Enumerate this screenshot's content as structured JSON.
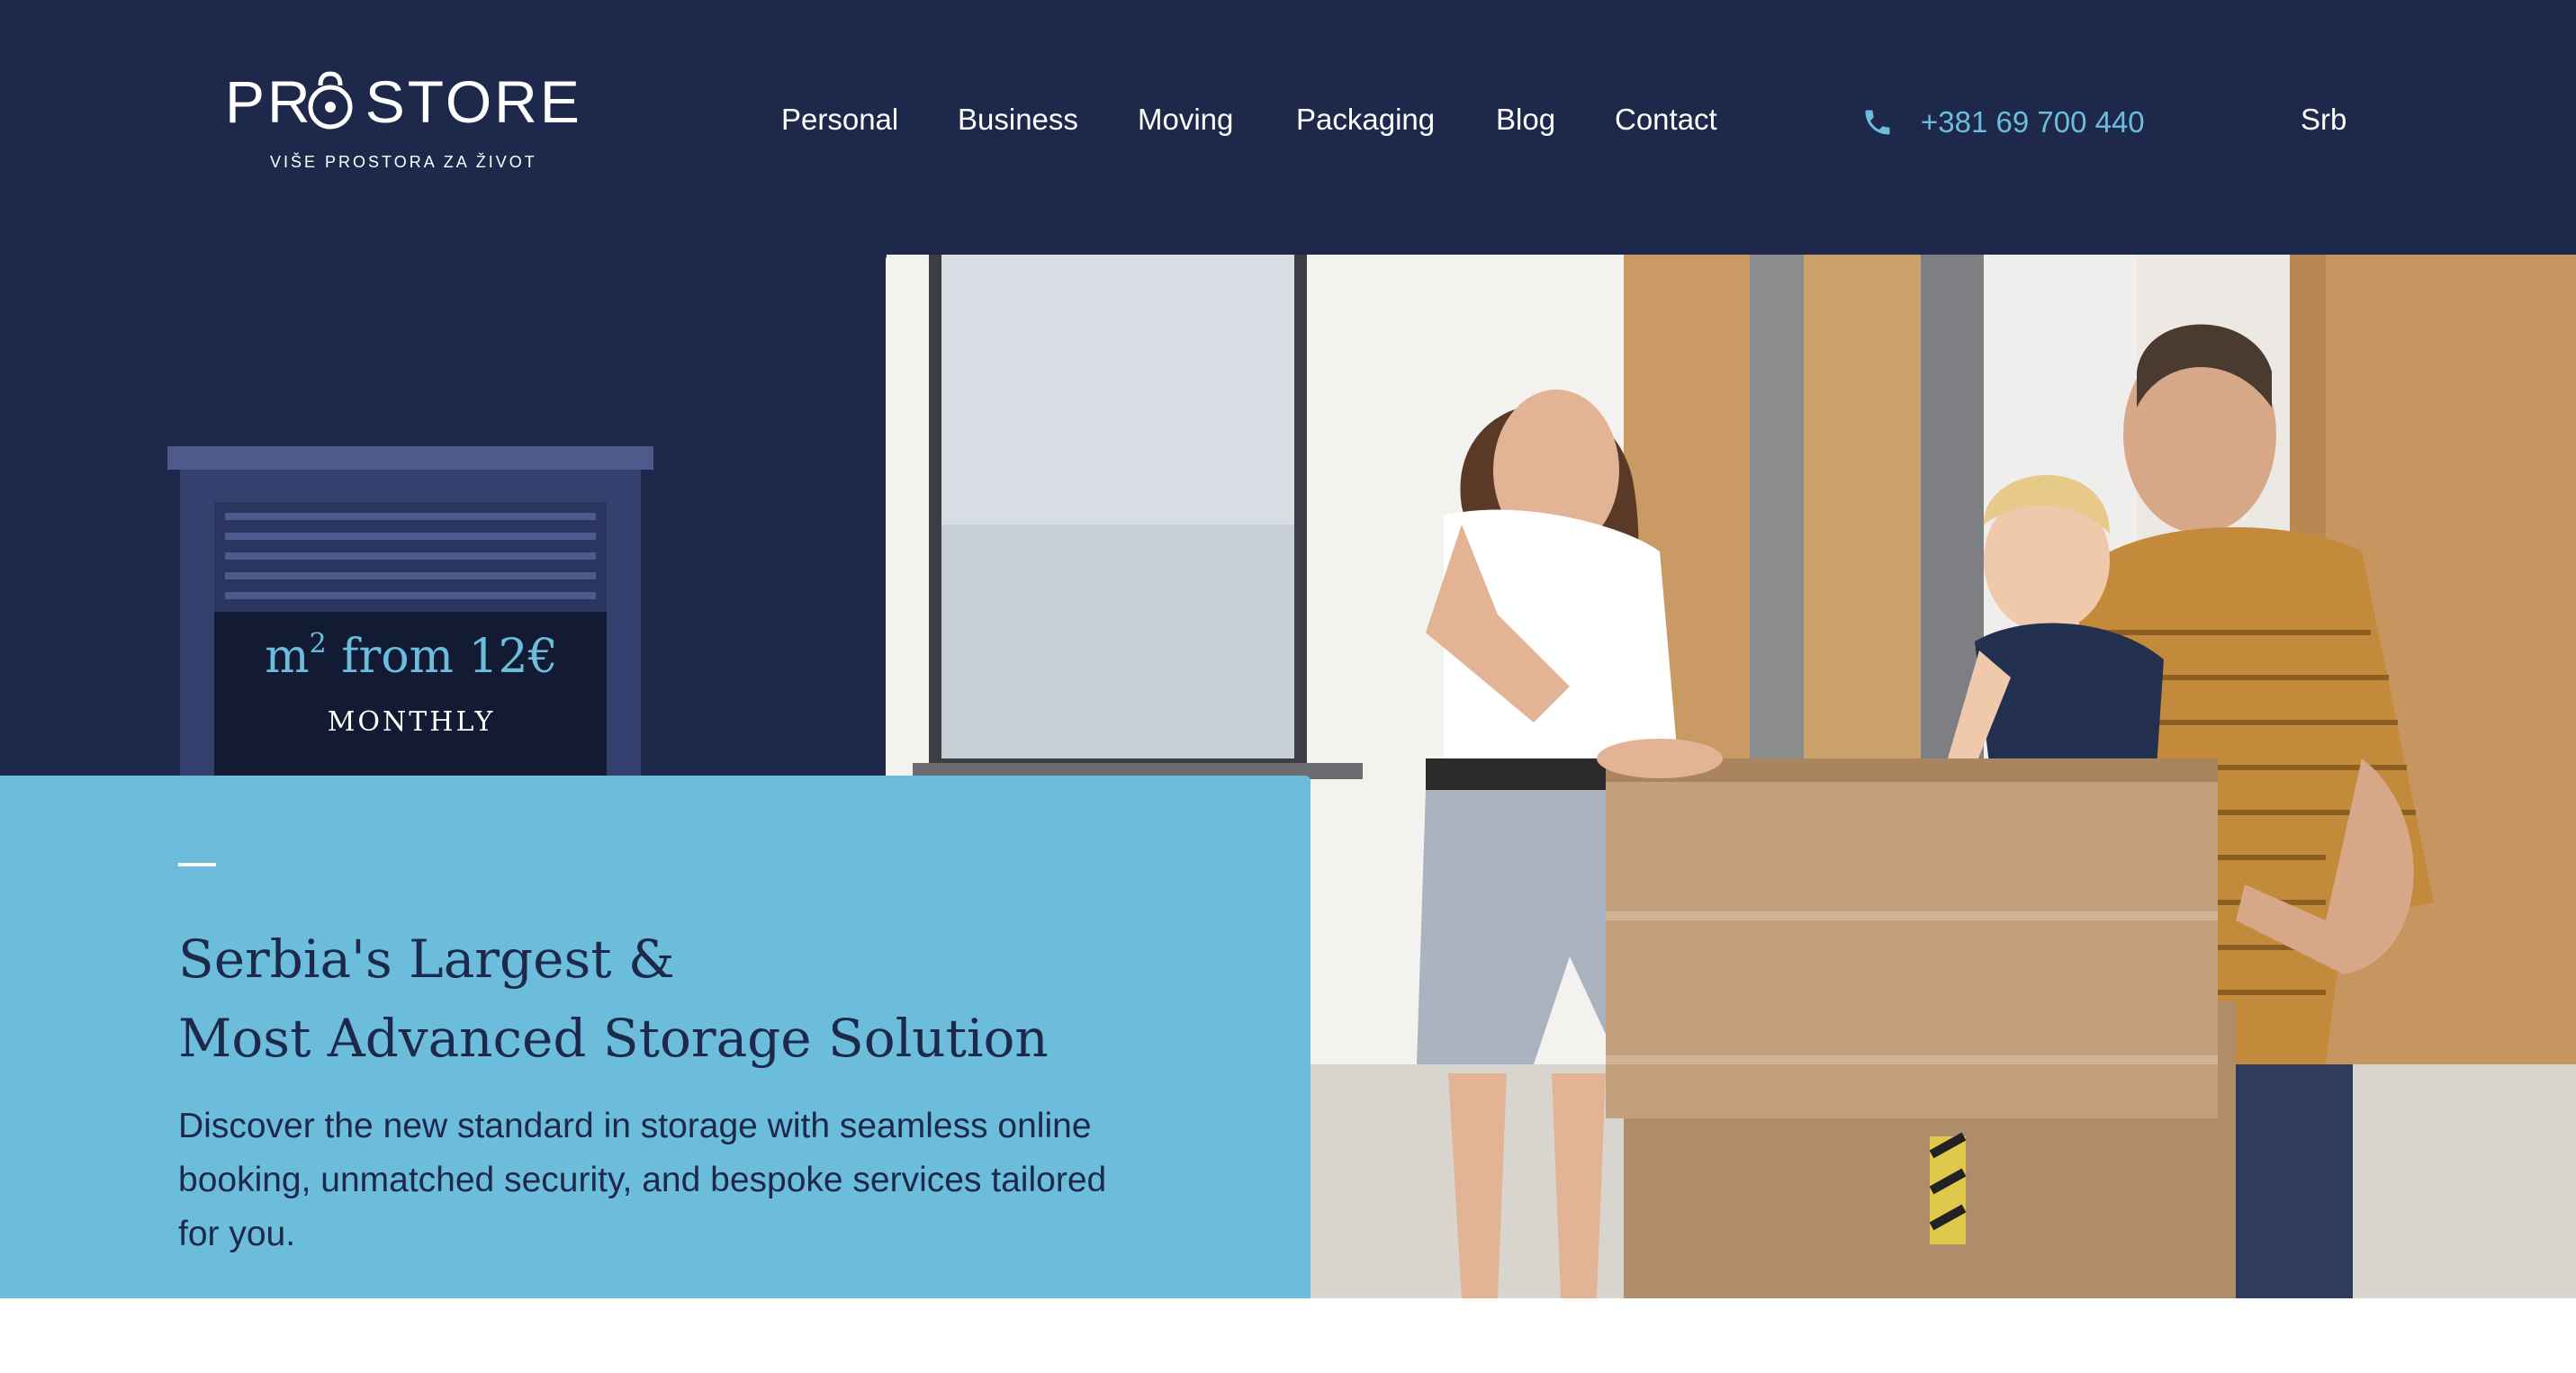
{
  "brand": {
    "logo_text_pre": "PR",
    "logo_text_post": "STORE",
    "tagline": "VIŠE PROSTORA ZA ŽIVOT"
  },
  "nav": {
    "items": [
      {
        "label": "Personal"
      },
      {
        "label": "Business"
      },
      {
        "label": "Moving"
      },
      {
        "label": "Packaging"
      },
      {
        "label": "Blog"
      },
      {
        "label": "Contact"
      }
    ]
  },
  "contact": {
    "phone": "+381 69 700 440",
    "phone_icon": "phone-icon"
  },
  "language": {
    "current": "Srb"
  },
  "offer": {
    "unit": "m",
    "unit_power": "2",
    "price_text": "from 12€",
    "period": "MONTHLY"
  },
  "hero": {
    "title_line1": "Serbia's Largest &",
    "title_line2": "Most Advanced Storage Solution",
    "description": "Discover the new standard in storage with seamless online booking, unmatched security, and bespoke services tailored for you."
  },
  "colors": {
    "navy": "#1d284b",
    "accent_blue": "#6bbddb",
    "unit_frame": "#34406d",
    "unit_dark": "#131a33"
  }
}
